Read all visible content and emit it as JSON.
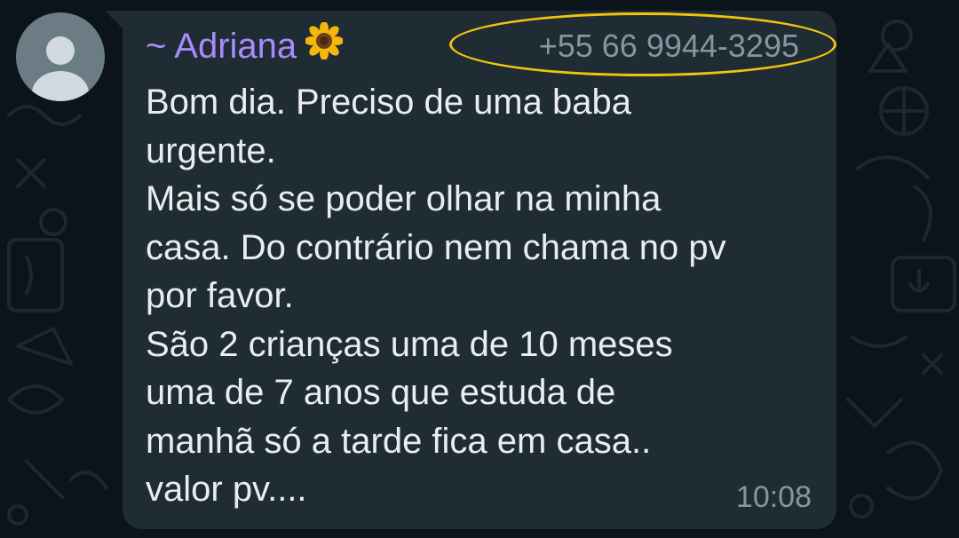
{
  "message": {
    "sender_name": "~ Adriana",
    "sender_emoji": "sunflower-emoji",
    "phone_number": "+55 66 9944-3295",
    "lines": [
      "Bom dia. Preciso de uma baba",
      "urgente.",
      "Mais só se poder olhar na minha",
      "casa. Do contrário nem chama no pv",
      "por favor.",
      "São 2 crianças uma de 10 meses",
      "uma de 7 anos que estuda de",
      "manhã só a tarde fica em casa..",
      "valor pv...."
    ],
    "time": "10:08"
  },
  "colors": {
    "background": "#0b141a",
    "bubble": "#202c33",
    "sender_name": "#a78bfa",
    "highlight_circle": "#f1c40f",
    "meta_text": "#8696a0",
    "message_text": "#e9edef"
  }
}
